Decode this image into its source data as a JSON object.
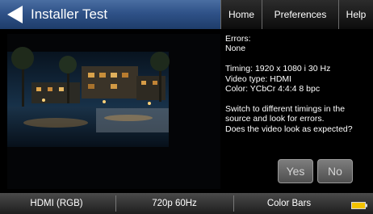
{
  "header": {
    "title": "Installer Test",
    "tabs": [
      "Home",
      "Preferences",
      "Help"
    ]
  },
  "info": {
    "errors_label": "Errors:",
    "errors_value": "None",
    "timing": "Timing: 1920 x 1080 i 30 Hz",
    "video_type": "Video type: HDMI",
    "color": "Color: YCbCr 4:4:4 8 bpc",
    "instructions": [
      "Switch to different timings in the",
      "source and look for errors.",
      "Does the video look as expected?"
    ]
  },
  "buttons": {
    "yes": "Yes",
    "no": "No"
  },
  "bottom_bar": {
    "format": "HDMI (RGB)",
    "timing": "720p 60Hz",
    "pattern": "Color Bars"
  },
  "icons": {
    "back": "back-arrow-icon",
    "battery": "battery-icon"
  },
  "colors": {
    "header_blue": "#2f5288",
    "battery_fill": "#f2c200"
  }
}
